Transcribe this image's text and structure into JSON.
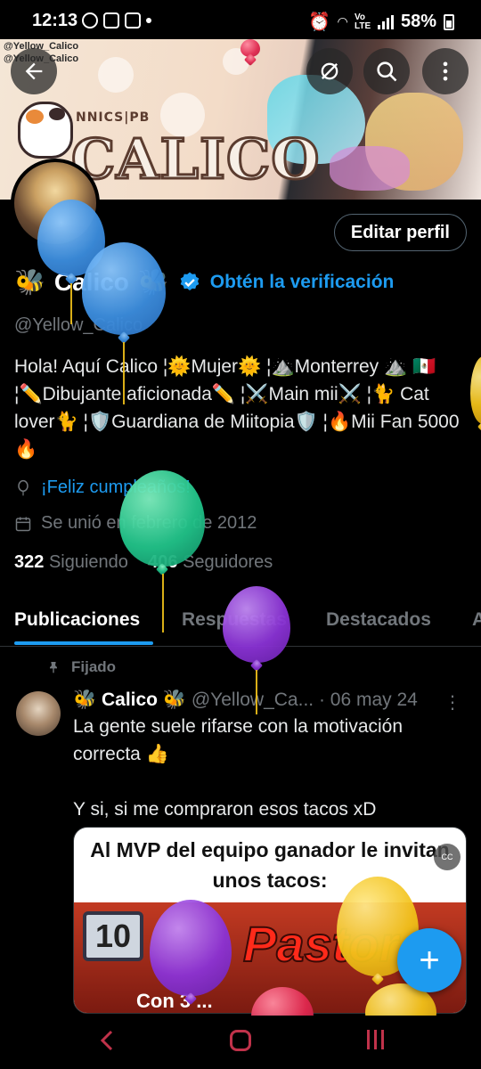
{
  "status_bar": {
    "time": "12:13",
    "battery": "58%",
    "network_label": "Vo LTE"
  },
  "banner": {
    "brand_small": "NNICS|PB",
    "brand": "CALICO",
    "watermark_1": "@Yellow_Calico",
    "watermark_2": "@Yellow_Calico"
  },
  "header_buttons": {
    "back_icon": "arrow-left-icon",
    "grok_icon": "grok-icon",
    "search_icon": "search-icon",
    "more_icon": "more-vertical-icon"
  },
  "profile": {
    "edit_button": "Editar perfil",
    "name_prefix_emoji": "🐝",
    "name": "Calico",
    "name_suffix_emoji": "🐝",
    "verify_text": "Obtén la verificación",
    "handle": "@Yellow_Calico",
    "bio": "Hola! Aquí Calico ¦🌞Mujer🌞 ¦⛰️Monterrey ⛰️ 🇲🇽 ¦✏️Dibujante aficionada✏️ ¦⚔️Main mii⚔️ ¦🐈 Cat lover🐈 ¦🛡️Guardiana de Miitopia🛡️ ¦🔥Mii Fan 5000🔥",
    "birthday": "¡Feliz cumpleaños!",
    "joined": "Se unió en febrero de 2012",
    "following_count": "322",
    "following_label": "Siguiendo",
    "followers_count": "406",
    "followers_label": "Seguidores"
  },
  "tabs": [
    {
      "label": "Publicaciones",
      "active": true
    },
    {
      "label": "Respuestas",
      "active": false
    },
    {
      "label": "Destacados",
      "active": false
    },
    {
      "label": "A",
      "active": false
    }
  ],
  "pinned_post": {
    "pinned_label": "Fijado",
    "author_name": "🐝 Calico 🐝",
    "author_meta": "@Yellow_Ca... · 06 may 24",
    "text": "La gente suele rifarse con la motivación correcta 👍\n\nY si, si me compraron esos tacos xD",
    "media_caption": "Al MVP del equipo ganador le invitan unos tacos:",
    "media_badge": "10",
    "media_word": "Pastor",
    "media_sub": "Con 3 ...",
    "cc_label": "CC"
  },
  "fab": {
    "label": "+"
  },
  "colors": {
    "accent": "#1d9bf0",
    "background": "#000000",
    "muted_text": "#71767b",
    "nav_accent": "#c0324a"
  }
}
